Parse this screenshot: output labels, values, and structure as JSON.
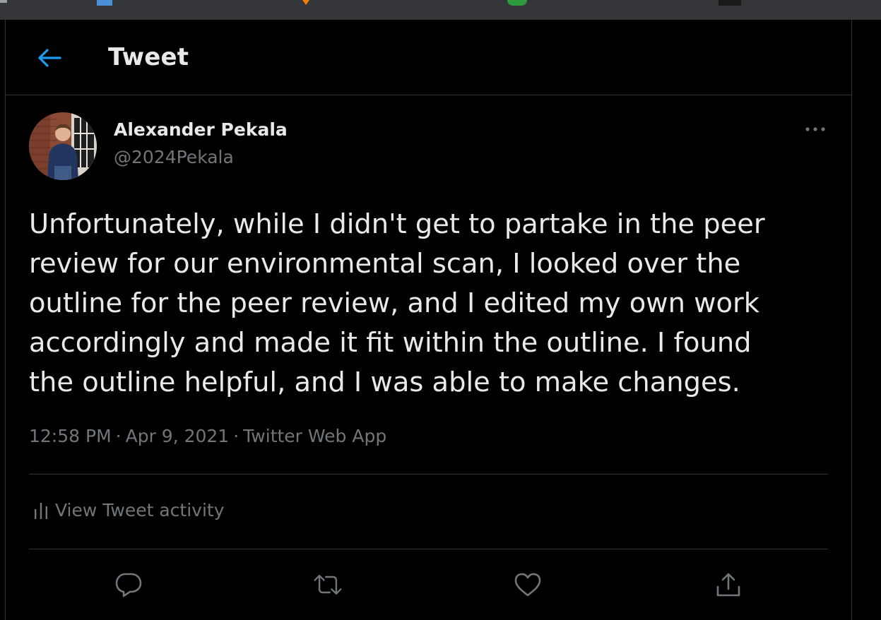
{
  "header": {
    "title": "Tweet"
  },
  "author": {
    "name": "Alexander Pekala",
    "handle": "@2024Pekala"
  },
  "tweet": {
    "lines": [
      "Unfortunately, while I didn't get to partake in the peer",
      "review for our environmental scan, I looked over the",
      "outline for the peer review, and I edited my own work",
      "accordingly and made it fit within the outline. I found",
      "the outline helpful, and I was able to make changes."
    ],
    "time": "12:58 PM",
    "date": "Apr 9, 2021",
    "separator": "·",
    "source": "Twitter Web App"
  },
  "activity": {
    "label": "View Tweet activity"
  },
  "actions": [
    {
      "icon": "reply-icon"
    },
    {
      "icon": "retweet-icon"
    },
    {
      "icon": "like-icon"
    },
    {
      "icon": "share-icon"
    }
  ],
  "colors": {
    "accent": "#1d9bf0",
    "text": "#e7e9ea",
    "secondary": "#71767b",
    "border": "#2f3336",
    "background": "#000000"
  }
}
